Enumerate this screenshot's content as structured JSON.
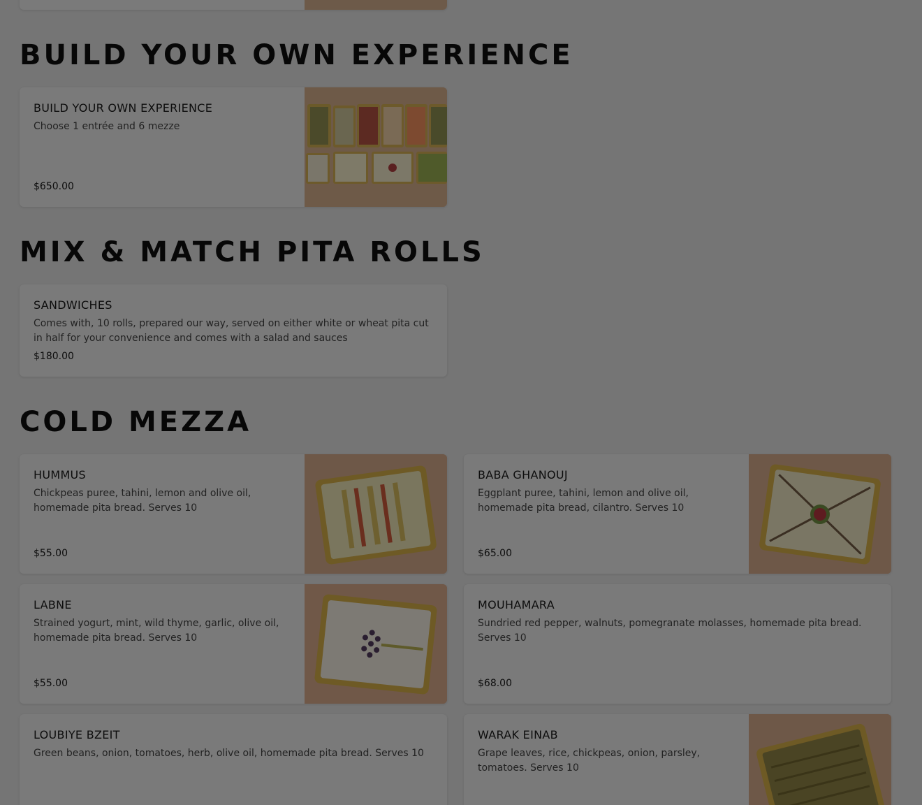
{
  "sections": {
    "build": {
      "heading": "BUILD YOUR OWN EXPERIENCE",
      "items": [
        {
          "title": "BUILD YOUR OWN EXPERIENCE",
          "desc": "Choose 1 entrée and 6 mezze",
          "price": "$650.00"
        }
      ]
    },
    "pita": {
      "heading": "MIX & MATCH PITA ROLLS",
      "items": [
        {
          "title": "SANDWICHES",
          "desc": "Comes with, 10 rolls, prepared our way, served on either white or wheat pita cut in half for your convenience and comes with a salad and sauces",
          "price": "$180.00"
        }
      ]
    },
    "cold": {
      "heading": "COLD MEZZA",
      "items": [
        {
          "title": "HUMMUS",
          "desc": "Chickpeas puree, tahini, lemon and olive oil, homemade pita bread. Serves 10",
          "price": "$55.00"
        },
        {
          "title": "BABA GHANOUJ",
          "desc": "Eggplant puree, tahini, lemon and olive oil, homemade pita bread, cilantro. Serves 10",
          "price": "$65.00"
        },
        {
          "title": "LABNE",
          "desc": "Strained yogurt, mint, wild thyme, garlic, olive oil, homemade pita bread. Serves 10",
          "price": "$55.00"
        },
        {
          "title": "MOUHAMARA",
          "desc": "Sundried red pepper, walnuts, pomegranate molasses, homemade pita bread. Serves 10",
          "price": "$68.00"
        },
        {
          "title": "LOUBIYE BZEIT",
          "desc": "Green beans, onion, tomatoes, herb, olive oil, homemade pita bread. Serves 10"
        },
        {
          "title": "WARAK EINAB",
          "desc": "Grape leaves, rice, chickpeas, onion, parsley, tomatoes. Serves 10"
        }
      ]
    }
  },
  "icons": {
    "mezze_spread": "mezze-spread-photo",
    "hummus": "hummus-tray-photo",
    "baba_ghanouj": "baba-ghanouj-tray-photo",
    "labne": "labne-tray-photo",
    "warak_einab": "warak-einab-tray-photo"
  },
  "colors": {
    "overlay": "#757575",
    "card": "#7a7a7a",
    "text": "#0d0d0d"
  }
}
